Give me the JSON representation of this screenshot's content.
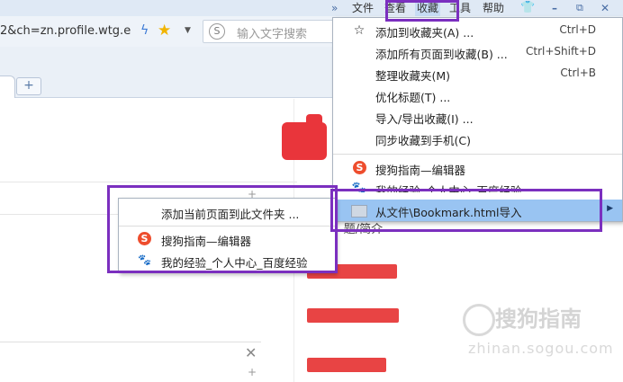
{
  "menubar": {
    "more": "»",
    "items": [
      "文件",
      "查看",
      "收藏",
      "工具",
      "帮助"
    ],
    "icons": [
      "shirt-icon",
      "minimize-icon",
      "restore-icon",
      "close-icon"
    ]
  },
  "address": {
    "url": "2&ch=zn.profile.wtg.e",
    "search_placeholder": "输入文字搜索"
  },
  "newtab_label": "+",
  "main_menu": {
    "items": [
      {
        "label": "添加到收藏夹(A) ...",
        "shortcut": "Ctrl+D",
        "icon": "star-outline-icon"
      },
      {
        "label": "添加所有页面到收藏(B) ...",
        "shortcut": "Ctrl+Shift+D"
      },
      {
        "label": "整理收藏夹(M)",
        "shortcut": "Ctrl+B"
      },
      {
        "label": "优化标题(T) ..."
      },
      {
        "label": "导入/导出收藏(I) ..."
      },
      {
        "label": "同步收藏到手机(C)"
      }
    ],
    "favorites": [
      {
        "label": "搜狗指南—编辑器",
        "icon": "sogou-icon"
      },
      {
        "label": "我的经验_个人中心_百度经验",
        "icon": "baidu-paw-icon"
      }
    ],
    "import_item": {
      "label": "从文件\\Bookmark.html导入",
      "icon": "folder-icon"
    }
  },
  "submenu": {
    "add_current": "添加当前页面到此文件夹 ...",
    "items": [
      {
        "label": "搜狗指南—编辑器",
        "icon": "sogou-icon"
      },
      {
        "label": "我的经验_个人中心_百度经验",
        "icon": "baidu-paw-icon"
      }
    ]
  },
  "page": {
    "side_text": "-题/简介"
  },
  "watermark": {
    "text": "搜狗指南",
    "sub": "zhinan.sogou.com"
  },
  "colors": {
    "highlight": "#7b2fbf",
    "selected_item": "#99c4f2",
    "redaction": "#e84444"
  }
}
